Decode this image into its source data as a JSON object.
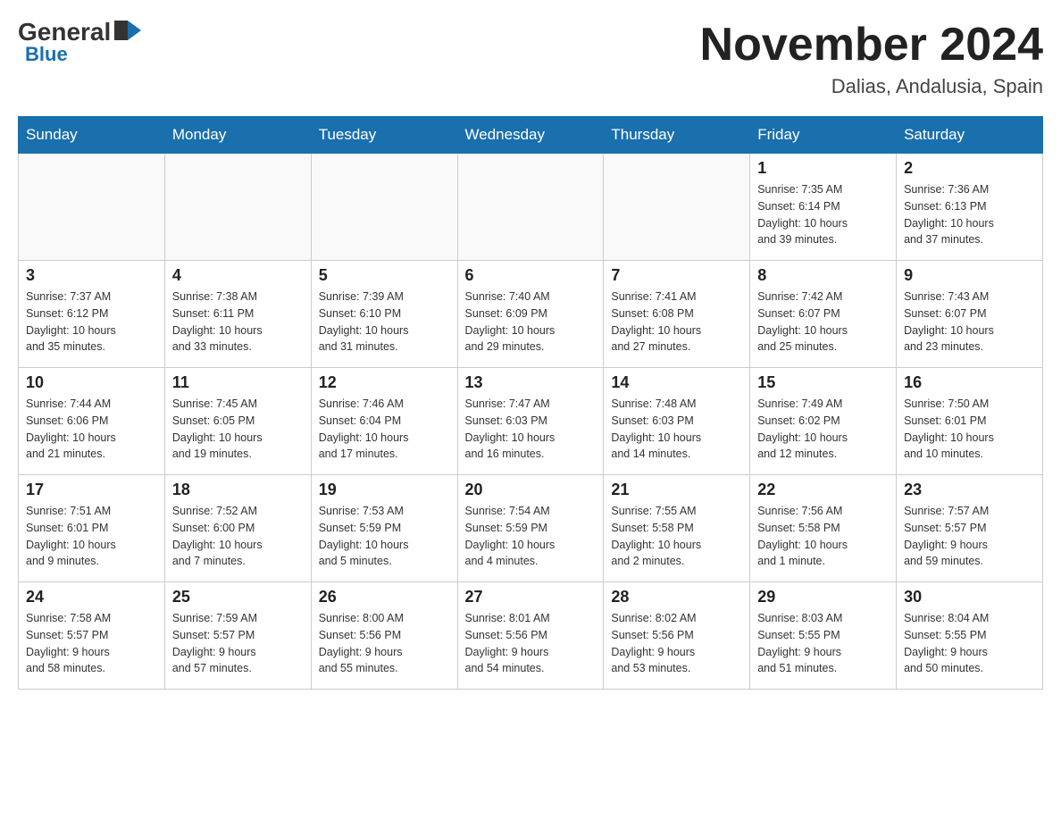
{
  "logo": {
    "general": "General",
    "blue": "Blue"
  },
  "title": "November 2024",
  "subtitle": "Dalias, Andalusia, Spain",
  "days_of_week": [
    "Sunday",
    "Monday",
    "Tuesday",
    "Wednesday",
    "Thursday",
    "Friday",
    "Saturday"
  ],
  "weeks": [
    [
      {
        "day": "",
        "info": ""
      },
      {
        "day": "",
        "info": ""
      },
      {
        "day": "",
        "info": ""
      },
      {
        "day": "",
        "info": ""
      },
      {
        "day": "",
        "info": ""
      },
      {
        "day": "1",
        "info": "Sunrise: 7:35 AM\nSunset: 6:14 PM\nDaylight: 10 hours\nand 39 minutes."
      },
      {
        "day": "2",
        "info": "Sunrise: 7:36 AM\nSunset: 6:13 PM\nDaylight: 10 hours\nand 37 minutes."
      }
    ],
    [
      {
        "day": "3",
        "info": "Sunrise: 7:37 AM\nSunset: 6:12 PM\nDaylight: 10 hours\nand 35 minutes."
      },
      {
        "day": "4",
        "info": "Sunrise: 7:38 AM\nSunset: 6:11 PM\nDaylight: 10 hours\nand 33 minutes."
      },
      {
        "day": "5",
        "info": "Sunrise: 7:39 AM\nSunset: 6:10 PM\nDaylight: 10 hours\nand 31 minutes."
      },
      {
        "day": "6",
        "info": "Sunrise: 7:40 AM\nSunset: 6:09 PM\nDaylight: 10 hours\nand 29 minutes."
      },
      {
        "day": "7",
        "info": "Sunrise: 7:41 AM\nSunset: 6:08 PM\nDaylight: 10 hours\nand 27 minutes."
      },
      {
        "day": "8",
        "info": "Sunrise: 7:42 AM\nSunset: 6:07 PM\nDaylight: 10 hours\nand 25 minutes."
      },
      {
        "day": "9",
        "info": "Sunrise: 7:43 AM\nSunset: 6:07 PM\nDaylight: 10 hours\nand 23 minutes."
      }
    ],
    [
      {
        "day": "10",
        "info": "Sunrise: 7:44 AM\nSunset: 6:06 PM\nDaylight: 10 hours\nand 21 minutes."
      },
      {
        "day": "11",
        "info": "Sunrise: 7:45 AM\nSunset: 6:05 PM\nDaylight: 10 hours\nand 19 minutes."
      },
      {
        "day": "12",
        "info": "Sunrise: 7:46 AM\nSunset: 6:04 PM\nDaylight: 10 hours\nand 17 minutes."
      },
      {
        "day": "13",
        "info": "Sunrise: 7:47 AM\nSunset: 6:03 PM\nDaylight: 10 hours\nand 16 minutes."
      },
      {
        "day": "14",
        "info": "Sunrise: 7:48 AM\nSunset: 6:03 PM\nDaylight: 10 hours\nand 14 minutes."
      },
      {
        "day": "15",
        "info": "Sunrise: 7:49 AM\nSunset: 6:02 PM\nDaylight: 10 hours\nand 12 minutes."
      },
      {
        "day": "16",
        "info": "Sunrise: 7:50 AM\nSunset: 6:01 PM\nDaylight: 10 hours\nand 10 minutes."
      }
    ],
    [
      {
        "day": "17",
        "info": "Sunrise: 7:51 AM\nSunset: 6:01 PM\nDaylight: 10 hours\nand 9 minutes."
      },
      {
        "day": "18",
        "info": "Sunrise: 7:52 AM\nSunset: 6:00 PM\nDaylight: 10 hours\nand 7 minutes."
      },
      {
        "day": "19",
        "info": "Sunrise: 7:53 AM\nSunset: 5:59 PM\nDaylight: 10 hours\nand 5 minutes."
      },
      {
        "day": "20",
        "info": "Sunrise: 7:54 AM\nSunset: 5:59 PM\nDaylight: 10 hours\nand 4 minutes."
      },
      {
        "day": "21",
        "info": "Sunrise: 7:55 AM\nSunset: 5:58 PM\nDaylight: 10 hours\nand 2 minutes."
      },
      {
        "day": "22",
        "info": "Sunrise: 7:56 AM\nSunset: 5:58 PM\nDaylight: 10 hours\nand 1 minute."
      },
      {
        "day": "23",
        "info": "Sunrise: 7:57 AM\nSunset: 5:57 PM\nDaylight: 9 hours\nand 59 minutes."
      }
    ],
    [
      {
        "day": "24",
        "info": "Sunrise: 7:58 AM\nSunset: 5:57 PM\nDaylight: 9 hours\nand 58 minutes."
      },
      {
        "day": "25",
        "info": "Sunrise: 7:59 AM\nSunset: 5:57 PM\nDaylight: 9 hours\nand 57 minutes."
      },
      {
        "day": "26",
        "info": "Sunrise: 8:00 AM\nSunset: 5:56 PM\nDaylight: 9 hours\nand 55 minutes."
      },
      {
        "day": "27",
        "info": "Sunrise: 8:01 AM\nSunset: 5:56 PM\nDaylight: 9 hours\nand 54 minutes."
      },
      {
        "day": "28",
        "info": "Sunrise: 8:02 AM\nSunset: 5:56 PM\nDaylight: 9 hours\nand 53 minutes."
      },
      {
        "day": "29",
        "info": "Sunrise: 8:03 AM\nSunset: 5:55 PM\nDaylight: 9 hours\nand 51 minutes."
      },
      {
        "day": "30",
        "info": "Sunrise: 8:04 AM\nSunset: 5:55 PM\nDaylight: 9 hours\nand 50 minutes."
      }
    ]
  ]
}
